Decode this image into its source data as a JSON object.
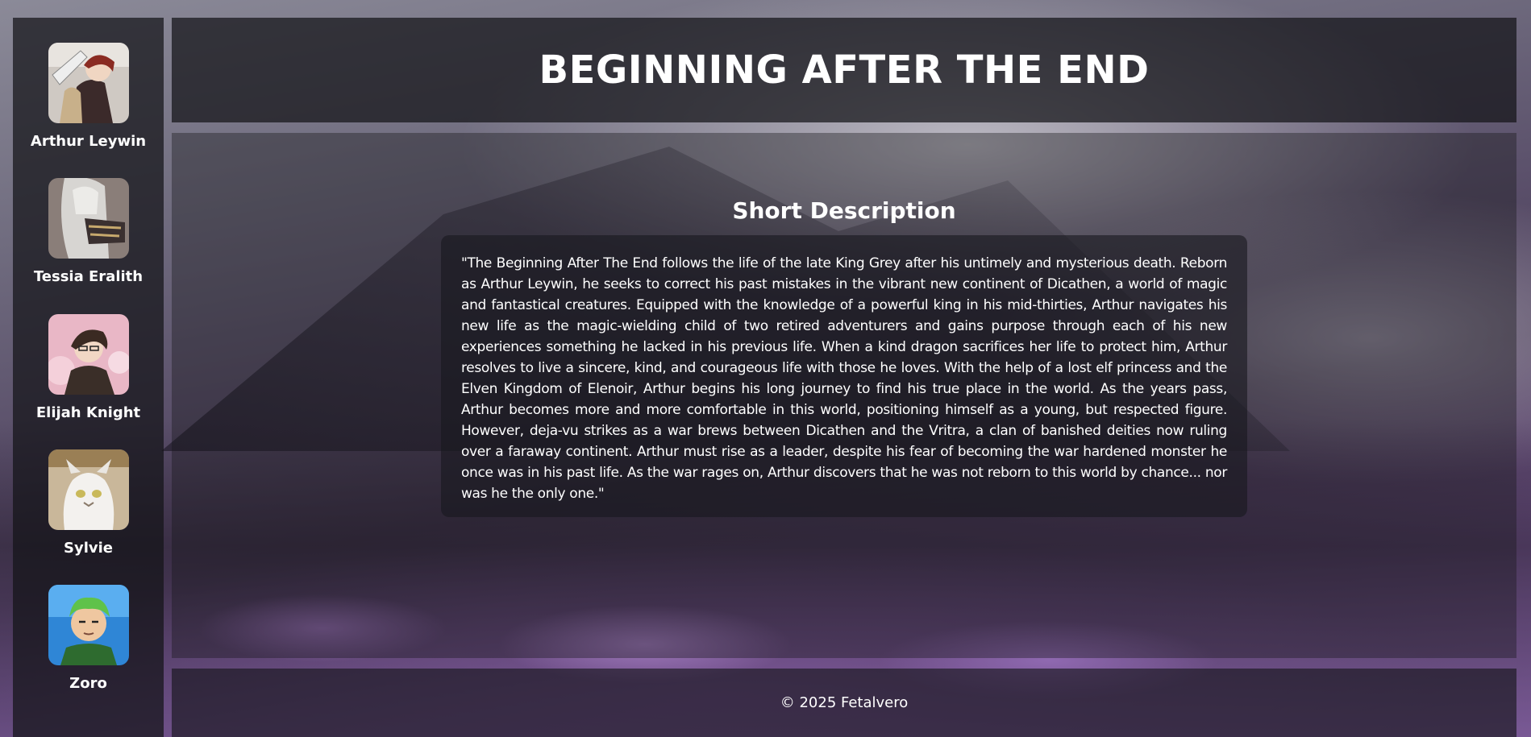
{
  "header": {
    "title": "BEGINNING AFTER THE END"
  },
  "sidebar": {
    "characters": [
      {
        "name": "Arthur Leywin",
        "icon": "arthur-leywin-portrait"
      },
      {
        "name": "Tessia Eralith",
        "icon": "tessia-eralith-portrait"
      },
      {
        "name": "Elijah Knight",
        "icon": "elijah-knight-portrait"
      },
      {
        "name": "Sylvie",
        "icon": "sylvie-portrait"
      },
      {
        "name": "Zoro",
        "icon": "zoro-portrait"
      }
    ]
  },
  "main": {
    "section_title": "Short Description",
    "description": "\"The Beginning After The End follows the life of the late King Grey after his untimely and mysterious death. Reborn as Arthur Leywin, he seeks to correct his past mistakes in the vibrant new continent of Dicathen, a world of magic and fantastical creatures. Equipped with the knowledge of a powerful king in his mid-thirties, Arthur navigates his new life as the magic-wielding child of two retired adventurers and gains purpose through each of his new experiences something he lacked in his previous life. When a kind dragon sacrifices her life to protect him, Arthur resolves to live a sincere, kind, and courageous life with those he loves. With the help of a lost elf princess and the Elven Kingdom of Elenoir, Arthur begins his long journey to find his true place in the world. As the years pass, Arthur becomes more and more comfortable in this world, positioning himself as a young, but respected figure. However, deja-vu strikes as a war brews between Dicathen and the Vritra, a clan of banished deities now ruling over a faraway continent. Arthur must rise as a leader, despite his fear of becoming the war hardened monster he once was in his past life. As the war rages on, Arthur discovers that he was not reborn to this world by chance... nor was he the only one.\""
  },
  "footer": {
    "copyright": "© 2025 Fetalvero"
  },
  "colors": {
    "panel": "#141418",
    "text": "#ffffff",
    "accent_purple": "#8a67a3"
  }
}
